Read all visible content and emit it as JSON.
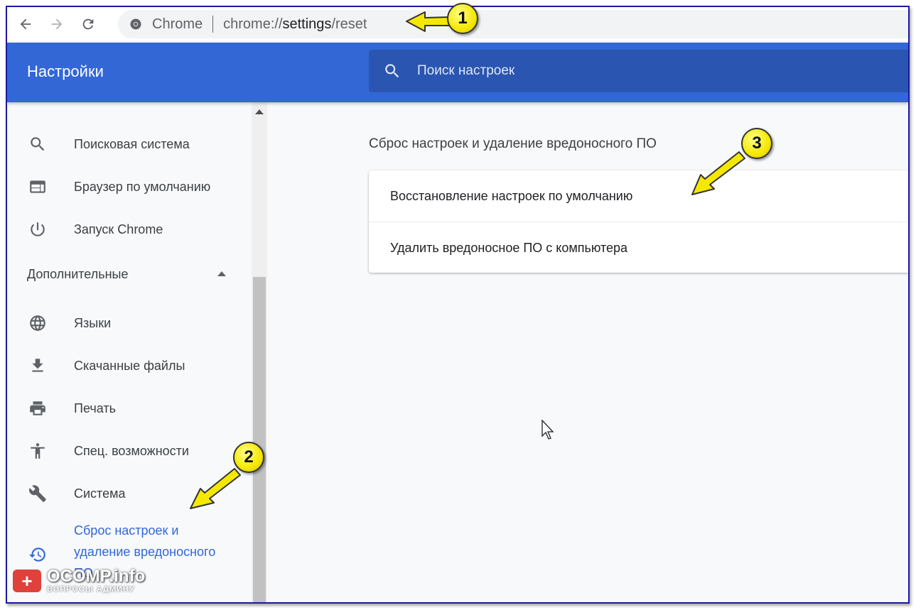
{
  "browser": {
    "omnibox_site": "Chrome",
    "url_prefix": "chrome://",
    "url_highlight": "settings",
    "url_suffix": "/reset"
  },
  "header": {
    "title": "Настройки",
    "search_placeholder": "Поиск настроек"
  },
  "sidebar": {
    "items": [
      {
        "label": "Поисковая система",
        "icon": "search-icon"
      },
      {
        "label": "Браузер по умолчанию",
        "icon": "browser-window-icon"
      },
      {
        "label": "Запуск Chrome",
        "icon": "power-icon"
      }
    ],
    "advanced_section": "Дополнительные",
    "advanced_items": [
      {
        "label": "Языки",
        "icon": "globe-icon"
      },
      {
        "label": "Скачанные файлы",
        "icon": "download-icon"
      },
      {
        "label": "Печать",
        "icon": "print-icon"
      },
      {
        "label": "Спец. возможности",
        "icon": "accessibility-icon"
      },
      {
        "label": "Система",
        "icon": "wrench-icon"
      },
      {
        "label": "Сброс настроек и удаление вредоносного ПО",
        "label_line1": "Сброс настроек и",
        "label_line2": "удаление вредоносного",
        "label_line3": "ПО",
        "icon": "restore-icon",
        "active": true
      }
    ]
  },
  "main": {
    "section_title": "Сброс настроек и удаление вредоносного ПО",
    "rows": [
      {
        "label": "Восстановление настроек по умолчанию"
      },
      {
        "label": "Удалить вредоносное ПО с компьютера"
      }
    ]
  },
  "annotations": {
    "badge_1": "1",
    "badge_2": "2",
    "badge_3": "3",
    "arrow_color": "#f5e800"
  },
  "watermark": {
    "main": "OCOMP.info",
    "sub": "ВОПРОСЫ АДМИНУ"
  },
  "colors": {
    "header_blue": "#3367d6",
    "search_blue": "#2a55b0",
    "active_blue": "#3367d6"
  }
}
